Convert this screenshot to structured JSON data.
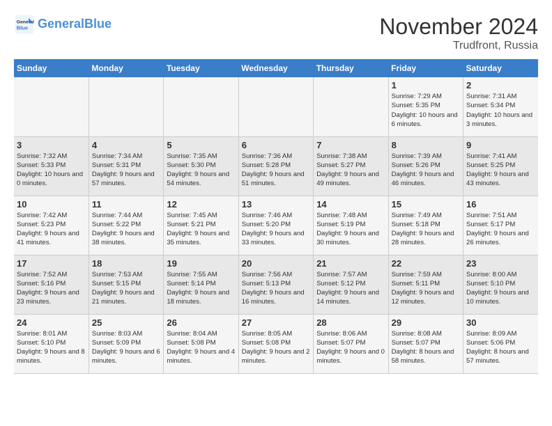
{
  "header": {
    "logo_line1": "General",
    "logo_line2": "Blue",
    "month": "November 2024",
    "location": "Trudfront, Russia"
  },
  "weekdays": [
    "Sunday",
    "Monday",
    "Tuesday",
    "Wednesday",
    "Thursday",
    "Friday",
    "Saturday"
  ],
  "weeks": [
    [
      {
        "day": "",
        "info": ""
      },
      {
        "day": "",
        "info": ""
      },
      {
        "day": "",
        "info": ""
      },
      {
        "day": "",
        "info": ""
      },
      {
        "day": "",
        "info": ""
      },
      {
        "day": "1",
        "info": "Sunrise: 7:29 AM\nSunset: 5:35 PM\nDaylight: 10 hours and 6 minutes."
      },
      {
        "day": "2",
        "info": "Sunrise: 7:31 AM\nSunset: 5:34 PM\nDaylight: 10 hours and 3 minutes."
      }
    ],
    [
      {
        "day": "3",
        "info": "Sunrise: 7:32 AM\nSunset: 5:33 PM\nDaylight: 10 hours and 0 minutes."
      },
      {
        "day": "4",
        "info": "Sunrise: 7:34 AM\nSunset: 5:31 PM\nDaylight: 9 hours and 57 minutes."
      },
      {
        "day": "5",
        "info": "Sunrise: 7:35 AM\nSunset: 5:30 PM\nDaylight: 9 hours and 54 minutes."
      },
      {
        "day": "6",
        "info": "Sunrise: 7:36 AM\nSunset: 5:28 PM\nDaylight: 9 hours and 51 minutes."
      },
      {
        "day": "7",
        "info": "Sunrise: 7:38 AM\nSunset: 5:27 PM\nDaylight: 9 hours and 49 minutes."
      },
      {
        "day": "8",
        "info": "Sunrise: 7:39 AM\nSunset: 5:26 PM\nDaylight: 9 hours and 46 minutes."
      },
      {
        "day": "9",
        "info": "Sunrise: 7:41 AM\nSunset: 5:25 PM\nDaylight: 9 hours and 43 minutes."
      }
    ],
    [
      {
        "day": "10",
        "info": "Sunrise: 7:42 AM\nSunset: 5:23 PM\nDaylight: 9 hours and 41 minutes."
      },
      {
        "day": "11",
        "info": "Sunrise: 7:44 AM\nSunset: 5:22 PM\nDaylight: 9 hours and 38 minutes."
      },
      {
        "day": "12",
        "info": "Sunrise: 7:45 AM\nSunset: 5:21 PM\nDaylight: 9 hours and 35 minutes."
      },
      {
        "day": "13",
        "info": "Sunrise: 7:46 AM\nSunset: 5:20 PM\nDaylight: 9 hours and 33 minutes."
      },
      {
        "day": "14",
        "info": "Sunrise: 7:48 AM\nSunset: 5:19 PM\nDaylight: 9 hours and 30 minutes."
      },
      {
        "day": "15",
        "info": "Sunrise: 7:49 AM\nSunset: 5:18 PM\nDaylight: 9 hours and 28 minutes."
      },
      {
        "day": "16",
        "info": "Sunrise: 7:51 AM\nSunset: 5:17 PM\nDaylight: 9 hours and 26 minutes."
      }
    ],
    [
      {
        "day": "17",
        "info": "Sunrise: 7:52 AM\nSunset: 5:16 PM\nDaylight: 9 hours and 23 minutes."
      },
      {
        "day": "18",
        "info": "Sunrise: 7:53 AM\nSunset: 5:15 PM\nDaylight: 9 hours and 21 minutes."
      },
      {
        "day": "19",
        "info": "Sunrise: 7:55 AM\nSunset: 5:14 PM\nDaylight: 9 hours and 18 minutes."
      },
      {
        "day": "20",
        "info": "Sunrise: 7:56 AM\nSunset: 5:13 PM\nDaylight: 9 hours and 16 minutes."
      },
      {
        "day": "21",
        "info": "Sunrise: 7:57 AM\nSunset: 5:12 PM\nDaylight: 9 hours and 14 minutes."
      },
      {
        "day": "22",
        "info": "Sunrise: 7:59 AM\nSunset: 5:11 PM\nDaylight: 9 hours and 12 minutes."
      },
      {
        "day": "23",
        "info": "Sunrise: 8:00 AM\nSunset: 5:10 PM\nDaylight: 9 hours and 10 minutes."
      }
    ],
    [
      {
        "day": "24",
        "info": "Sunrise: 8:01 AM\nSunset: 5:10 PM\nDaylight: 9 hours and 8 minutes."
      },
      {
        "day": "25",
        "info": "Sunrise: 8:03 AM\nSunset: 5:09 PM\nDaylight: 9 hours and 6 minutes."
      },
      {
        "day": "26",
        "info": "Sunrise: 8:04 AM\nSunset: 5:08 PM\nDaylight: 9 hours and 4 minutes."
      },
      {
        "day": "27",
        "info": "Sunrise: 8:05 AM\nSunset: 5:08 PM\nDaylight: 9 hours and 2 minutes."
      },
      {
        "day": "28",
        "info": "Sunrise: 8:06 AM\nSunset: 5:07 PM\nDaylight: 9 hours and 0 minutes."
      },
      {
        "day": "29",
        "info": "Sunrise: 8:08 AM\nSunset: 5:07 PM\nDaylight: 8 hours and 58 minutes."
      },
      {
        "day": "30",
        "info": "Sunrise: 8:09 AM\nSunset: 5:06 PM\nDaylight: 8 hours and 57 minutes."
      }
    ]
  ]
}
